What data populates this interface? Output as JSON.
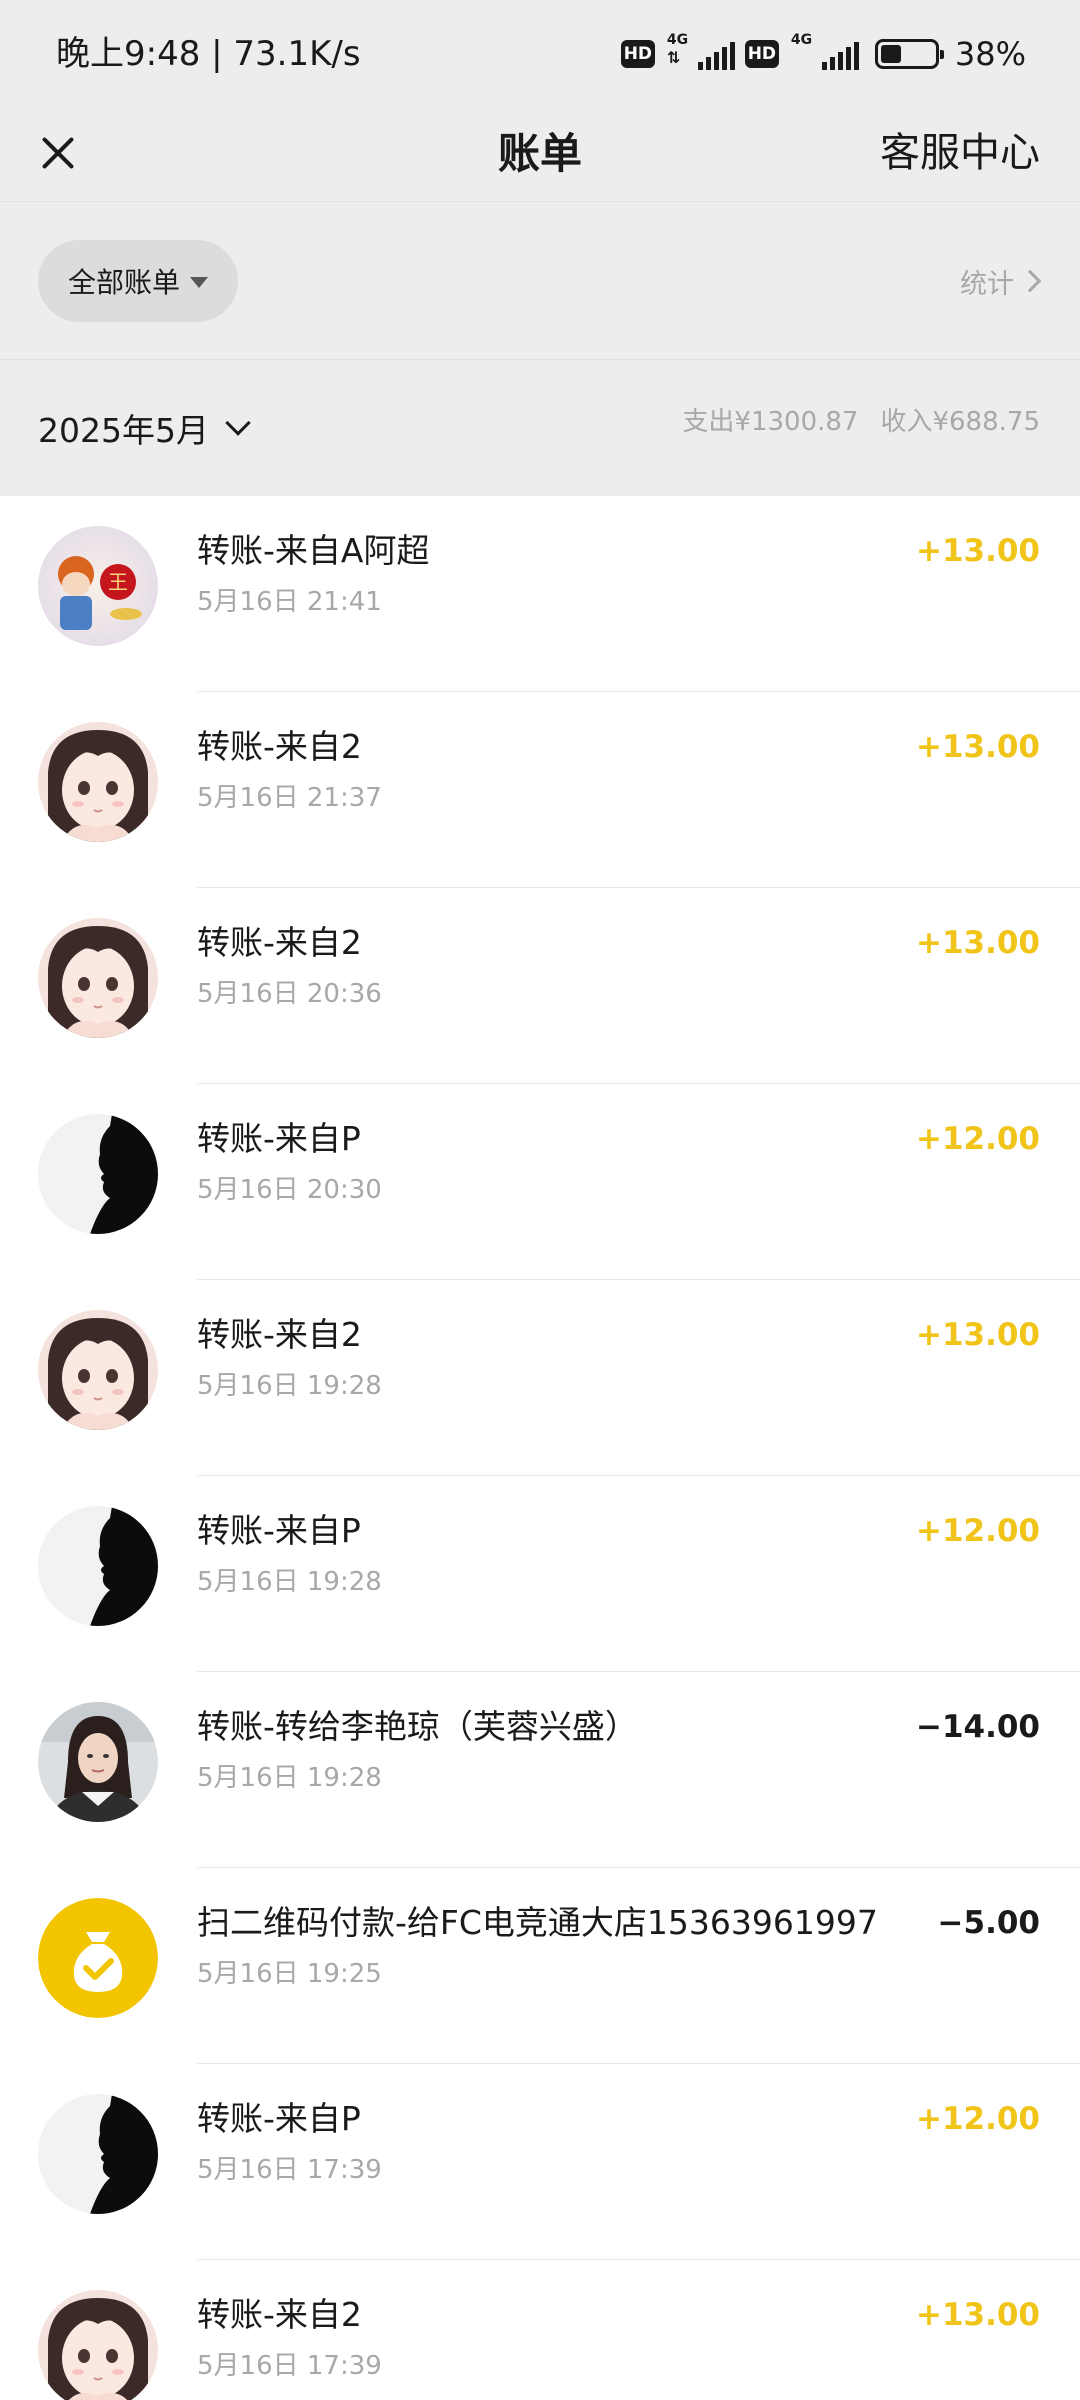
{
  "status_bar": {
    "time_speed": "晚上9:48 | 73.1K/s",
    "hd_label": "HD",
    "network_label": "4G",
    "battery_percent": "38%",
    "battery_level": 0.38
  },
  "nav": {
    "title": "账单",
    "service_label": "客服中心"
  },
  "filter": {
    "chip_label": "全部账单",
    "stats_label": "统计"
  },
  "month": {
    "label": "2025年5月",
    "expense": "支出¥1300.87",
    "income": "收入¥688.75"
  },
  "transactions": [
    {
      "avatar": "avatar-cartoon",
      "title": "转账-来自A阿超",
      "time": "5月16日 21:41",
      "amount": "+13.00",
      "direction": "in"
    },
    {
      "avatar": "avatar-anime-girl",
      "title": "转账-来自2",
      "time": "5月16日 21:37",
      "amount": "+13.00",
      "direction": "in"
    },
    {
      "avatar": "avatar-anime-girl",
      "title": "转账-来自2",
      "time": "5月16日 20:36",
      "amount": "+13.00",
      "direction": "in"
    },
    {
      "avatar": "avatar-silhouette",
      "title": "转账-来自P",
      "time": "5月16日 20:30",
      "amount": "+12.00",
      "direction": "in"
    },
    {
      "avatar": "avatar-anime-girl",
      "title": "转账-来自2",
      "time": "5月16日 19:28",
      "amount": "+13.00",
      "direction": "in"
    },
    {
      "avatar": "avatar-silhouette",
      "title": "转账-来自P",
      "time": "5月16日 19:28",
      "amount": "+12.00",
      "direction": "in"
    },
    {
      "avatar": "avatar-photo-woman",
      "title": "转账-转给李艳琼（芙蓉兴盛）",
      "time": "5月16日 19:28",
      "amount": "−14.00",
      "direction": "out"
    },
    {
      "avatar": "money-bag-icon",
      "title": "扫二维码付款-给FC电竞通大店15363961997",
      "time": "5月16日 19:25",
      "amount": "−5.00",
      "direction": "out"
    },
    {
      "avatar": "avatar-silhouette",
      "title": "转账-来自P",
      "time": "5月16日 17:39",
      "amount": "+12.00",
      "direction": "in"
    },
    {
      "avatar": "avatar-anime-girl",
      "title": "转账-来自2",
      "time": "5月16日 17:39",
      "amount": "+13.00",
      "direction": "in"
    }
  ],
  "colors": {
    "income": "#f1c419",
    "expense": "#1a1a1a",
    "header_bg": "#ededed",
    "muted_text": "#a8a8a8",
    "accent_yellow": "#f2c500"
  }
}
